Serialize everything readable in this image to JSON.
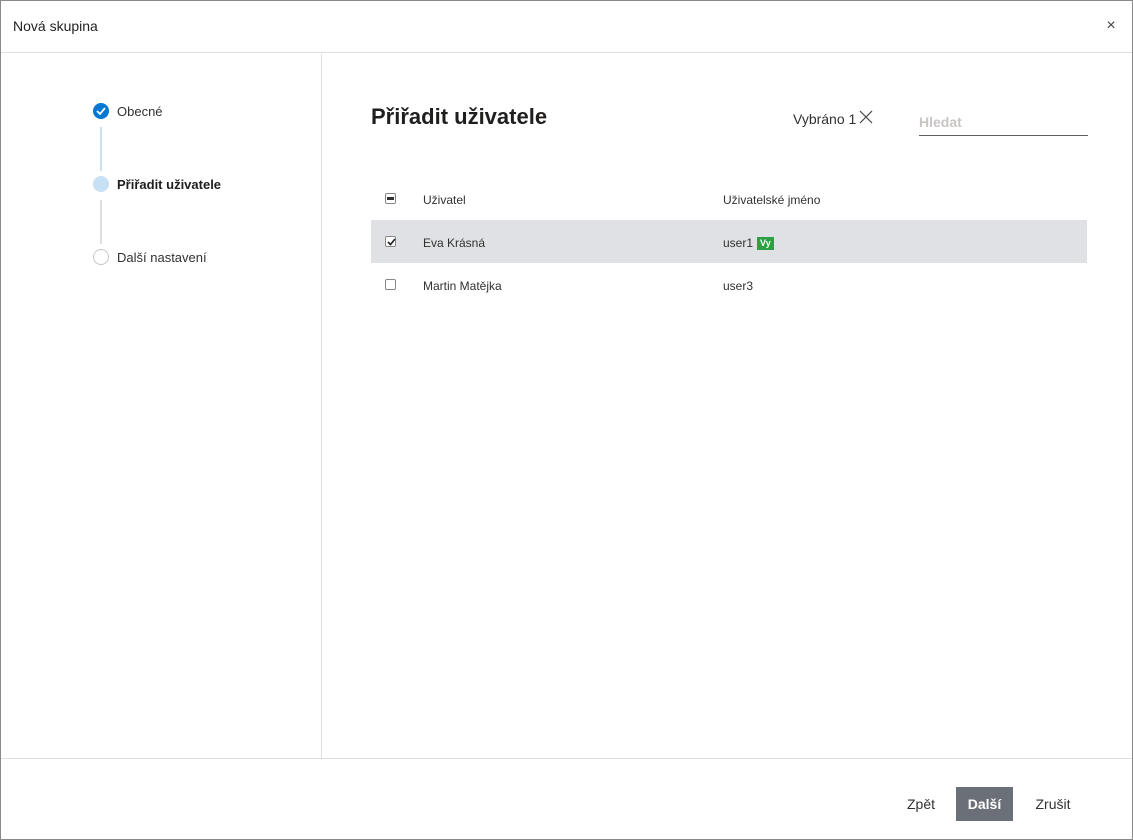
{
  "dialog": {
    "title": "Nová skupina",
    "close_icon": "close-icon"
  },
  "steps": [
    {
      "label": "Obecné",
      "state": "done",
      "icon": "checkmark-icon"
    },
    {
      "label": "Přiřadit uživatele",
      "state": "current"
    },
    {
      "label": "Další nastavení",
      "state": "todo"
    }
  ],
  "main": {
    "heading": "Přiřadit uživatele",
    "selected_text": "Vybráno 1",
    "clear_icon": "clear-selection-icon",
    "search_placeholder": "Hledat",
    "search_value": ""
  },
  "table": {
    "columns": [
      "Uživatel",
      "Uživatelské jméno"
    ],
    "header_checkbox": "partial",
    "rows": [
      {
        "user": "Eva Krásná",
        "login": "user1",
        "badge": "Vy",
        "checked": true
      },
      {
        "user": "Martin Matějka",
        "login": "user3",
        "badge": "",
        "checked": false
      }
    ]
  },
  "footer": {
    "back_label": "Zpět",
    "next_label": "Další",
    "cancel_label": "Zrušit"
  },
  "colors": {
    "accent": "#0078d4",
    "step_current": "#c7e0f4",
    "selected_row": "#dfe1e5",
    "badge": "#2ea043",
    "primary_button": "#6b7078"
  }
}
